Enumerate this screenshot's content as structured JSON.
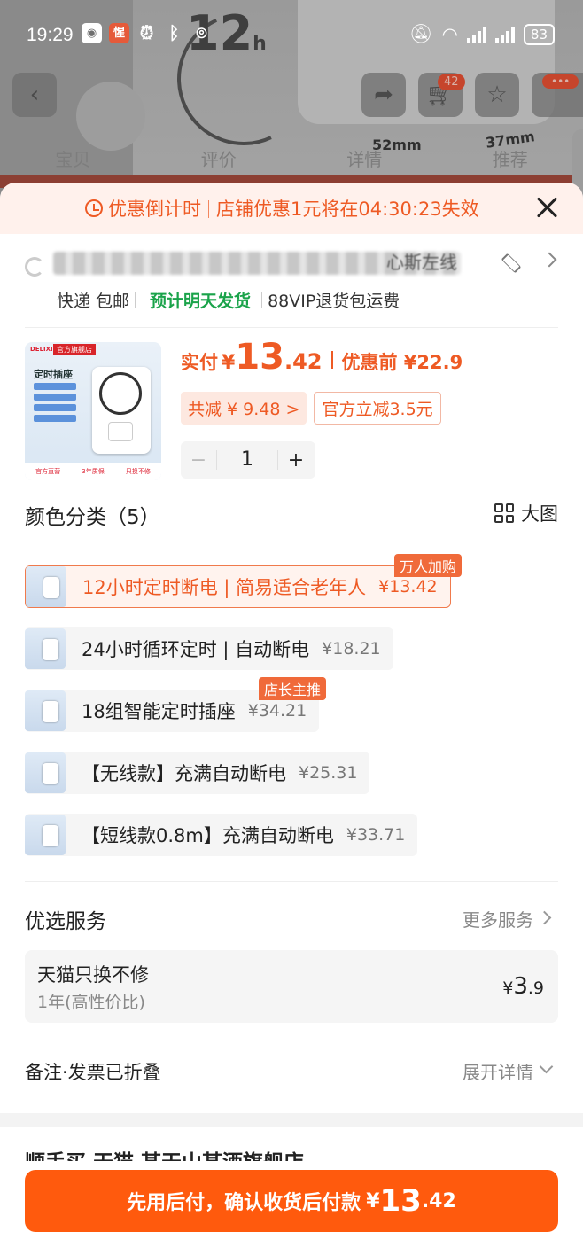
{
  "status_bar": {
    "time": "19:29",
    "battery": "83",
    "colors": {
      "text": "#ffffff"
    }
  },
  "background": {
    "big_label": "12",
    "big_label_unit": "h",
    "dimension_width": "52mm",
    "dimension_depth": "37mm",
    "cart_badge": "42",
    "more_badge": "•••",
    "tabs": [
      "宝贝",
      "评价",
      "详情",
      "推荐"
    ]
  },
  "countdown": {
    "label": "优惠倒计时",
    "message": "店铺优惠1元将在04:30:23失效"
  },
  "address": {
    "tail": "心斯左线",
    "delivery": "快递 包邮",
    "eta": "预计明天发货",
    "vip": "88VIP退货包运费"
  },
  "product": {
    "image_brand": "DELIXI",
    "image_flag": "官方旗舰店",
    "image_title": "定时插座",
    "image_footer": [
      "官方直营",
      "3年质保",
      "只换不修"
    ],
    "paid_label": "实付",
    "currency": "¥",
    "price_int": "13",
    "price_dec": ".42",
    "before_label": "优惠前 ¥22.9",
    "saving": "共减 ¥ 9.48 >",
    "official_cut": "官方立减3.5元",
    "quantity": "1",
    "minus": "−",
    "plus": "+"
  },
  "color_section": {
    "title": "颜色分类（5）",
    "big_view": "大图",
    "options": [
      {
        "name": "12小时定时断电 | 简易适合老年人",
        "price": "¥13.42",
        "tag": "万人加购",
        "selected": true
      },
      {
        "name": "24小时循环定时 | 自动断电",
        "price": "¥18.21",
        "tag": "",
        "selected": false
      },
      {
        "name": "18组智能定时插座",
        "price": "¥34.21",
        "tag": "店长主推",
        "selected": false
      },
      {
        "name": "【无线款】充满自动断电",
        "price": "¥25.31",
        "tag": "",
        "selected": false
      },
      {
        "name": "【短线款0.8m】充满自动断电",
        "price": "¥33.71",
        "tag": "",
        "selected": false
      }
    ]
  },
  "services": {
    "title": "优选服务",
    "more": "更多服务",
    "item_name": "天猫只换不修",
    "item_sub": "1年(高性价比)",
    "item_price_cur": "¥",
    "item_price_int": "3",
    "item_price_dec": ".9"
  },
  "note": {
    "label": "备注·发票已折叠",
    "expand": "展开详情"
  },
  "next_store": "顺手买 天猫 某天山某酒旗舰店",
  "cta": {
    "text": "先用后付，确认收货后付款",
    "currency": "¥",
    "price_int": "13",
    "price_dec": ".42",
    "color": "#ff5a0d"
  }
}
